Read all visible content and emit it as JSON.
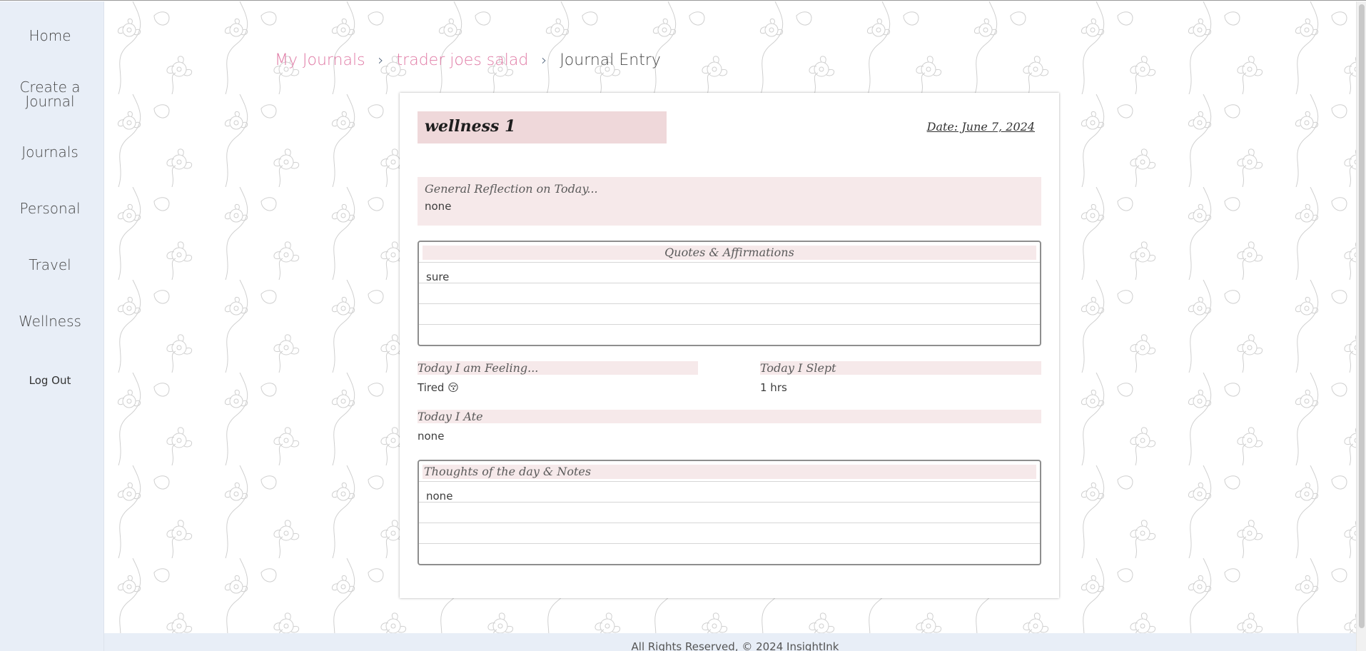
{
  "sidebar": {
    "items": [
      {
        "label": "Home"
      },
      {
        "label": "Create a Journal"
      },
      {
        "label": "Journals"
      },
      {
        "label": "Personal"
      },
      {
        "label": "Travel"
      },
      {
        "label": "Wellness"
      }
    ],
    "logout_label": "Log Out"
  },
  "breadcrumb": {
    "root": "My Journals",
    "journal": "trader joes salad",
    "current": "Journal Entry",
    "separator": "›"
  },
  "entry": {
    "title": "wellness 1",
    "date": "Date: June 7, 2024",
    "reflection_label": "General Reflection on Today...",
    "reflection_value": "none",
    "quotes_label": "Quotes & Affirmations",
    "quotes_value": "sure",
    "feeling_label": "Today I am Feeling...",
    "feeling_value": "Tired 😚",
    "slept_label": "Today I Slept",
    "slept_value": "1 hrs",
    "ate_label": "Today I Ate",
    "ate_value": "none",
    "notes_label": "Thoughts of the day & Notes",
    "notes_value": "none"
  },
  "footer": {
    "text": "All Rights Reserved, © 2024 InsightInk"
  },
  "colors": {
    "sidebar_bg": "#e8eef7",
    "accent_pink": "#e07aa5",
    "label_bg": "#f6e9ea",
    "title_bg": "#efd8da"
  }
}
